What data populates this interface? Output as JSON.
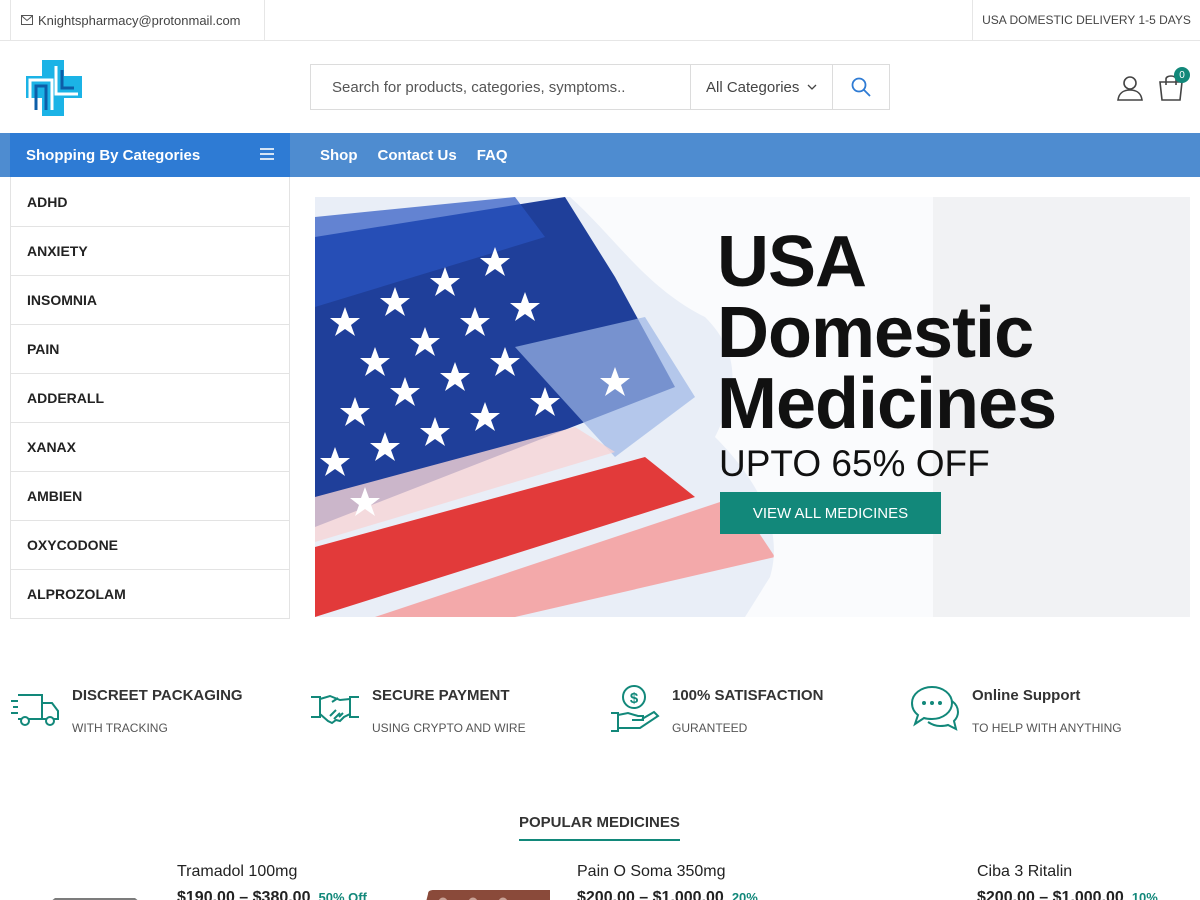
{
  "topbar": {
    "email": "Knightspharmacy@protonmail.com",
    "delivery": "USA DOMESTIC DELIVERY 1-5 DAYS"
  },
  "header": {
    "search_placeholder": "Search for products, categories, symptoms..",
    "category_select": "All Categories",
    "cart_count": "0"
  },
  "nav": {
    "categories_toggle": "Shopping By Categories",
    "links": [
      "Shop",
      "Contact Us",
      "FAQ"
    ]
  },
  "categories": [
    "ADHD",
    "ANXIETY",
    "INSOMNIA",
    "PAIN",
    "ADDERALL",
    "XANAX",
    "AMBIEN",
    "OXYCODONE",
    "ALPROZOLAM"
  ],
  "banner": {
    "line1": "USA",
    "line2": "Domestic",
    "line3": "Medicines",
    "subtitle": "UPTO 65% OFF",
    "button": "VIEW ALL MEDICINES"
  },
  "features": [
    {
      "title": "DISCREET PACKAGING",
      "subtitle": "WITH TRACKING",
      "icon": "delivery-truck-icon"
    },
    {
      "title": "SECURE PAYMENT",
      "subtitle": "USING CRYPTO AND WIRE",
      "icon": "handshake-icon"
    },
    {
      "title": "100% SATISFACTION",
      "subtitle": "GURANTEED",
      "icon": "money-hand-icon"
    },
    {
      "title": "Online Support",
      "subtitle": "TO HELP WITH ANYTHING",
      "icon": "chat-bubbles-icon"
    }
  ],
  "popular": {
    "title": "POPULAR MEDICINES",
    "products": [
      {
        "name": "Tramadol 100mg",
        "price_low": "$190.00",
        "price_high": "$380.00",
        "discount": "50% Off"
      },
      {
        "name": "Pain O Soma 350mg",
        "price_low": "$200.00",
        "price_high": "$1,000.00",
        "discount": "20%"
      },
      {
        "name": "Ciba 3 Ritalin",
        "price_low": "$200.00",
        "price_high": "$1,000.00",
        "discount": "10%"
      }
    ]
  },
  "colors": {
    "accent": "#12887a",
    "nav_bar": "#4e8cd0",
    "categories_toggle": "#2e7bd4"
  }
}
